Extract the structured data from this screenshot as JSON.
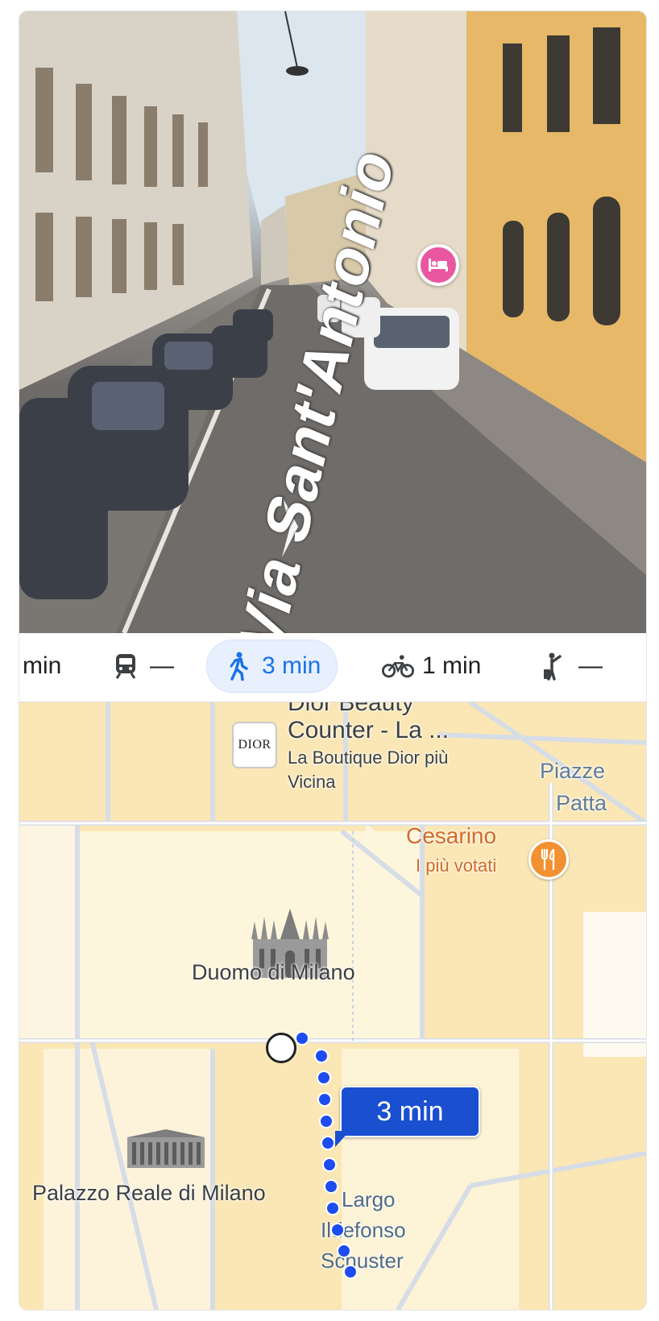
{
  "streetview": {
    "street_name": "Via Sant'Antonio",
    "hotel_pin_icon": "hotel-bed-icon"
  },
  "travel_modes": {
    "items": [
      {
        "id": "drive",
        "icon": "car-icon",
        "label": "min"
      },
      {
        "id": "transit",
        "icon": "train-icon",
        "label": "—"
      },
      {
        "id": "walk",
        "icon": "walking-icon",
        "label": "3 min",
        "selected": true
      },
      {
        "id": "bike",
        "icon": "bicycle-icon",
        "label": "1 min"
      },
      {
        "id": "ride",
        "icon": "ride-hail-icon",
        "label": "—"
      }
    ],
    "active_color": "#1a73e8"
  },
  "map": {
    "pois": {
      "dior": {
        "logo_text": "DIOR",
        "title_line1": "Dior Beauty",
        "title_line2": "Counter - La ...",
        "subtitle_line1": "La Boutique Dior più",
        "subtitle_line2": "Vicina"
      },
      "piazza": {
        "line1": "Piazze",
        "line2": "Patta"
      },
      "cesarino": {
        "title": "Cesarino",
        "subtitle": "I più votati",
        "icon": "restaurant-icon"
      },
      "duomo": {
        "title": "Duomo di Milano",
        "icon": "cathedral-icon"
      },
      "palazzo": {
        "title": "Palazzo Reale di Milano",
        "icon": "palace-icon"
      },
      "largo": {
        "line1": "Largo",
        "line2": "Ildefonso",
        "line3": "Schuster"
      }
    },
    "route": {
      "duration": "3 min",
      "color": "#1d4cf0"
    }
  }
}
